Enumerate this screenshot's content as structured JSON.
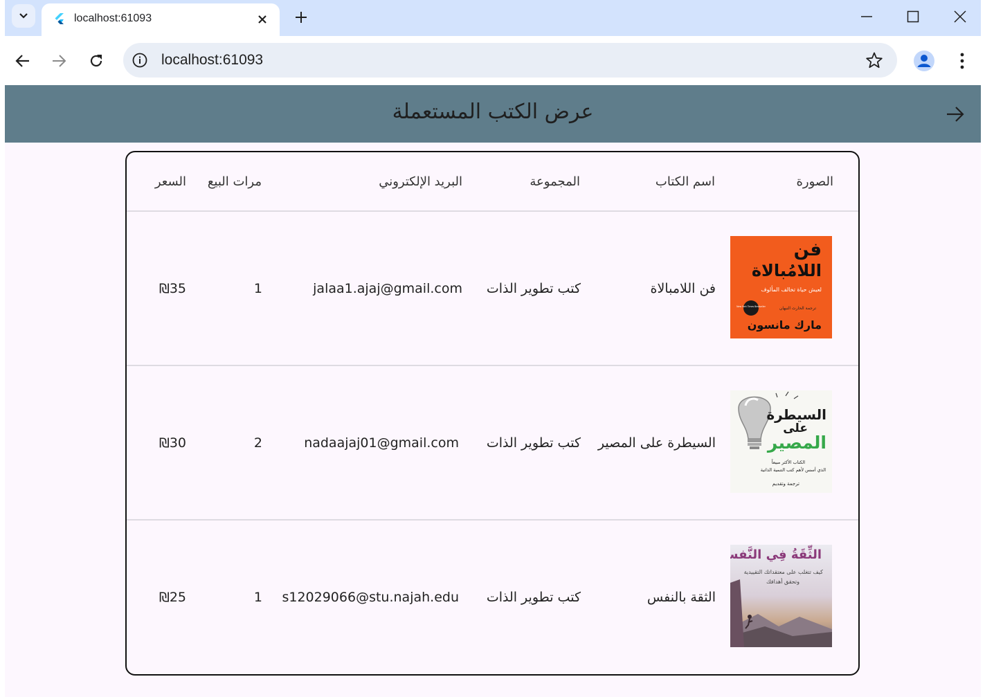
{
  "browser": {
    "tab_title": "localhost:61093",
    "url": "localhost:61093"
  },
  "app": {
    "title": "عرض الكتب المستعملة"
  },
  "table": {
    "headers": {
      "image": "الصورة",
      "book_name": "اسم الكتاب",
      "category": "المجموعة",
      "email": "البريد الإلكتروني",
      "sales_count": "مرات البيع",
      "price": "السعر"
    },
    "rows": [
      {
        "book_name": "فن اللامبالاة",
        "category": "كتب تطوير الذات",
        "email": "jalaa1.ajaj@gmail.com",
        "sales_count": "1",
        "price": "₪35",
        "cover": {
          "title_line1": "فن",
          "title_line2": "اللامُبالاة",
          "subtitle": "لعيش حياة تخالف المألوف",
          "translator": "ترجمة الحارث النبهان",
          "badge": "New York Times Bestseller",
          "author": "مارك مانسون",
          "bg_color": "#f25c1d"
        }
      },
      {
        "book_name": "السيطرة على المصير",
        "category": "كتب تطوير الذات",
        "email": "nadaajaj01@gmail.com",
        "sales_count": "2",
        "price": "₪30",
        "cover": {
          "title_line1": "السيطرة",
          "title_line2": "على",
          "title_line3": "المصير",
          "blurb1": "الكتاب الأكثر مبيعاً",
          "blurb2": "الذي أسس لأهم كتب التنمية الذاتية",
          "translator": "ترجمة وتقديم",
          "bg_color": "#f7f7f3",
          "accent_color": "#36a84a"
        }
      },
      {
        "book_name": "الثقة بالنفس",
        "category": "كتب تطوير الذات",
        "email": "s12029066@stu.najah.edu",
        "sales_count": "1",
        "price": "₪25",
        "cover": {
          "title": "الثِّقَةُ فِي النَّفسِ",
          "subtitle_line1": "كيف تتغلب على معتقداتك التقييدية",
          "subtitle_line2": "وتحقق أهدافك",
          "bg_color": "#e9e4ea",
          "title_color": "#8b3a7a"
        }
      }
    ]
  },
  "colors": {
    "appbar": "#5f7d8b",
    "content_bg": "#fdf7fe",
    "tabstrip": "#d3e3fd"
  }
}
